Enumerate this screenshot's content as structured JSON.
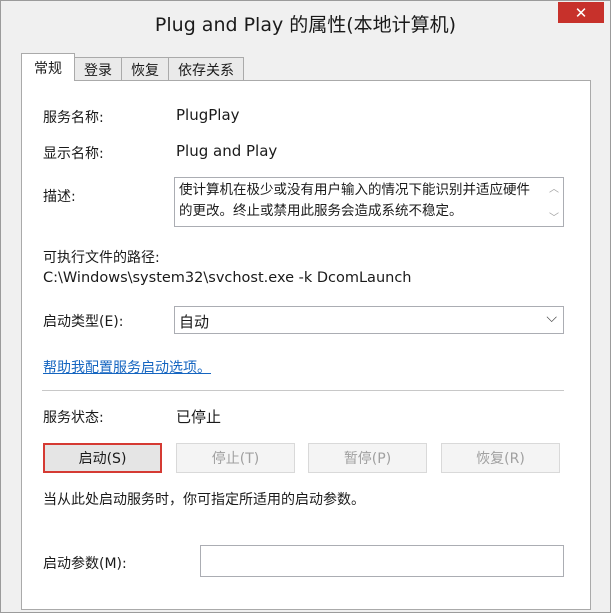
{
  "window": {
    "title": "Plug and Play 的属性(本地计算机)",
    "close_glyph": "✕"
  },
  "tabs": [
    {
      "label": "常规",
      "active": true
    },
    {
      "label": "登录",
      "active": false
    },
    {
      "label": "恢复",
      "active": false
    },
    {
      "label": "依存关系",
      "active": false
    }
  ],
  "general": {
    "service_name_label": "服务名称:",
    "service_name_value": "PlugPlay",
    "display_name_label": "显示名称:",
    "display_name_value": "Plug and Play",
    "description_label": "描述:",
    "description_value": "使计算机在极少或没有用户输入的情况下能识别并适应硬件的更改。终止或禁用此服务会造成系统不稳定。",
    "path_label": "可执行文件的路径:",
    "path_value": "C:\\Windows\\system32\\svchost.exe -k DcomLaunch",
    "startup_type_label": "启动类型(E):",
    "startup_type_value": "自动",
    "help_link": "帮助我配置服务启动选项。",
    "status_label": "服务状态:",
    "status_value": "已停止",
    "buttons": {
      "start": "启动(S)",
      "stop": "停止(T)",
      "pause": "暂停(P)",
      "resume": "恢复(R)"
    },
    "hint_text": "当从此处启动服务时，你可指定所适用的启动参数。",
    "start_params_label": "启动参数(M):",
    "start_params_value": ""
  },
  "colors": {
    "close_button": "#c7312b",
    "focus_border": "#d53a33",
    "link": "#1565c0"
  }
}
